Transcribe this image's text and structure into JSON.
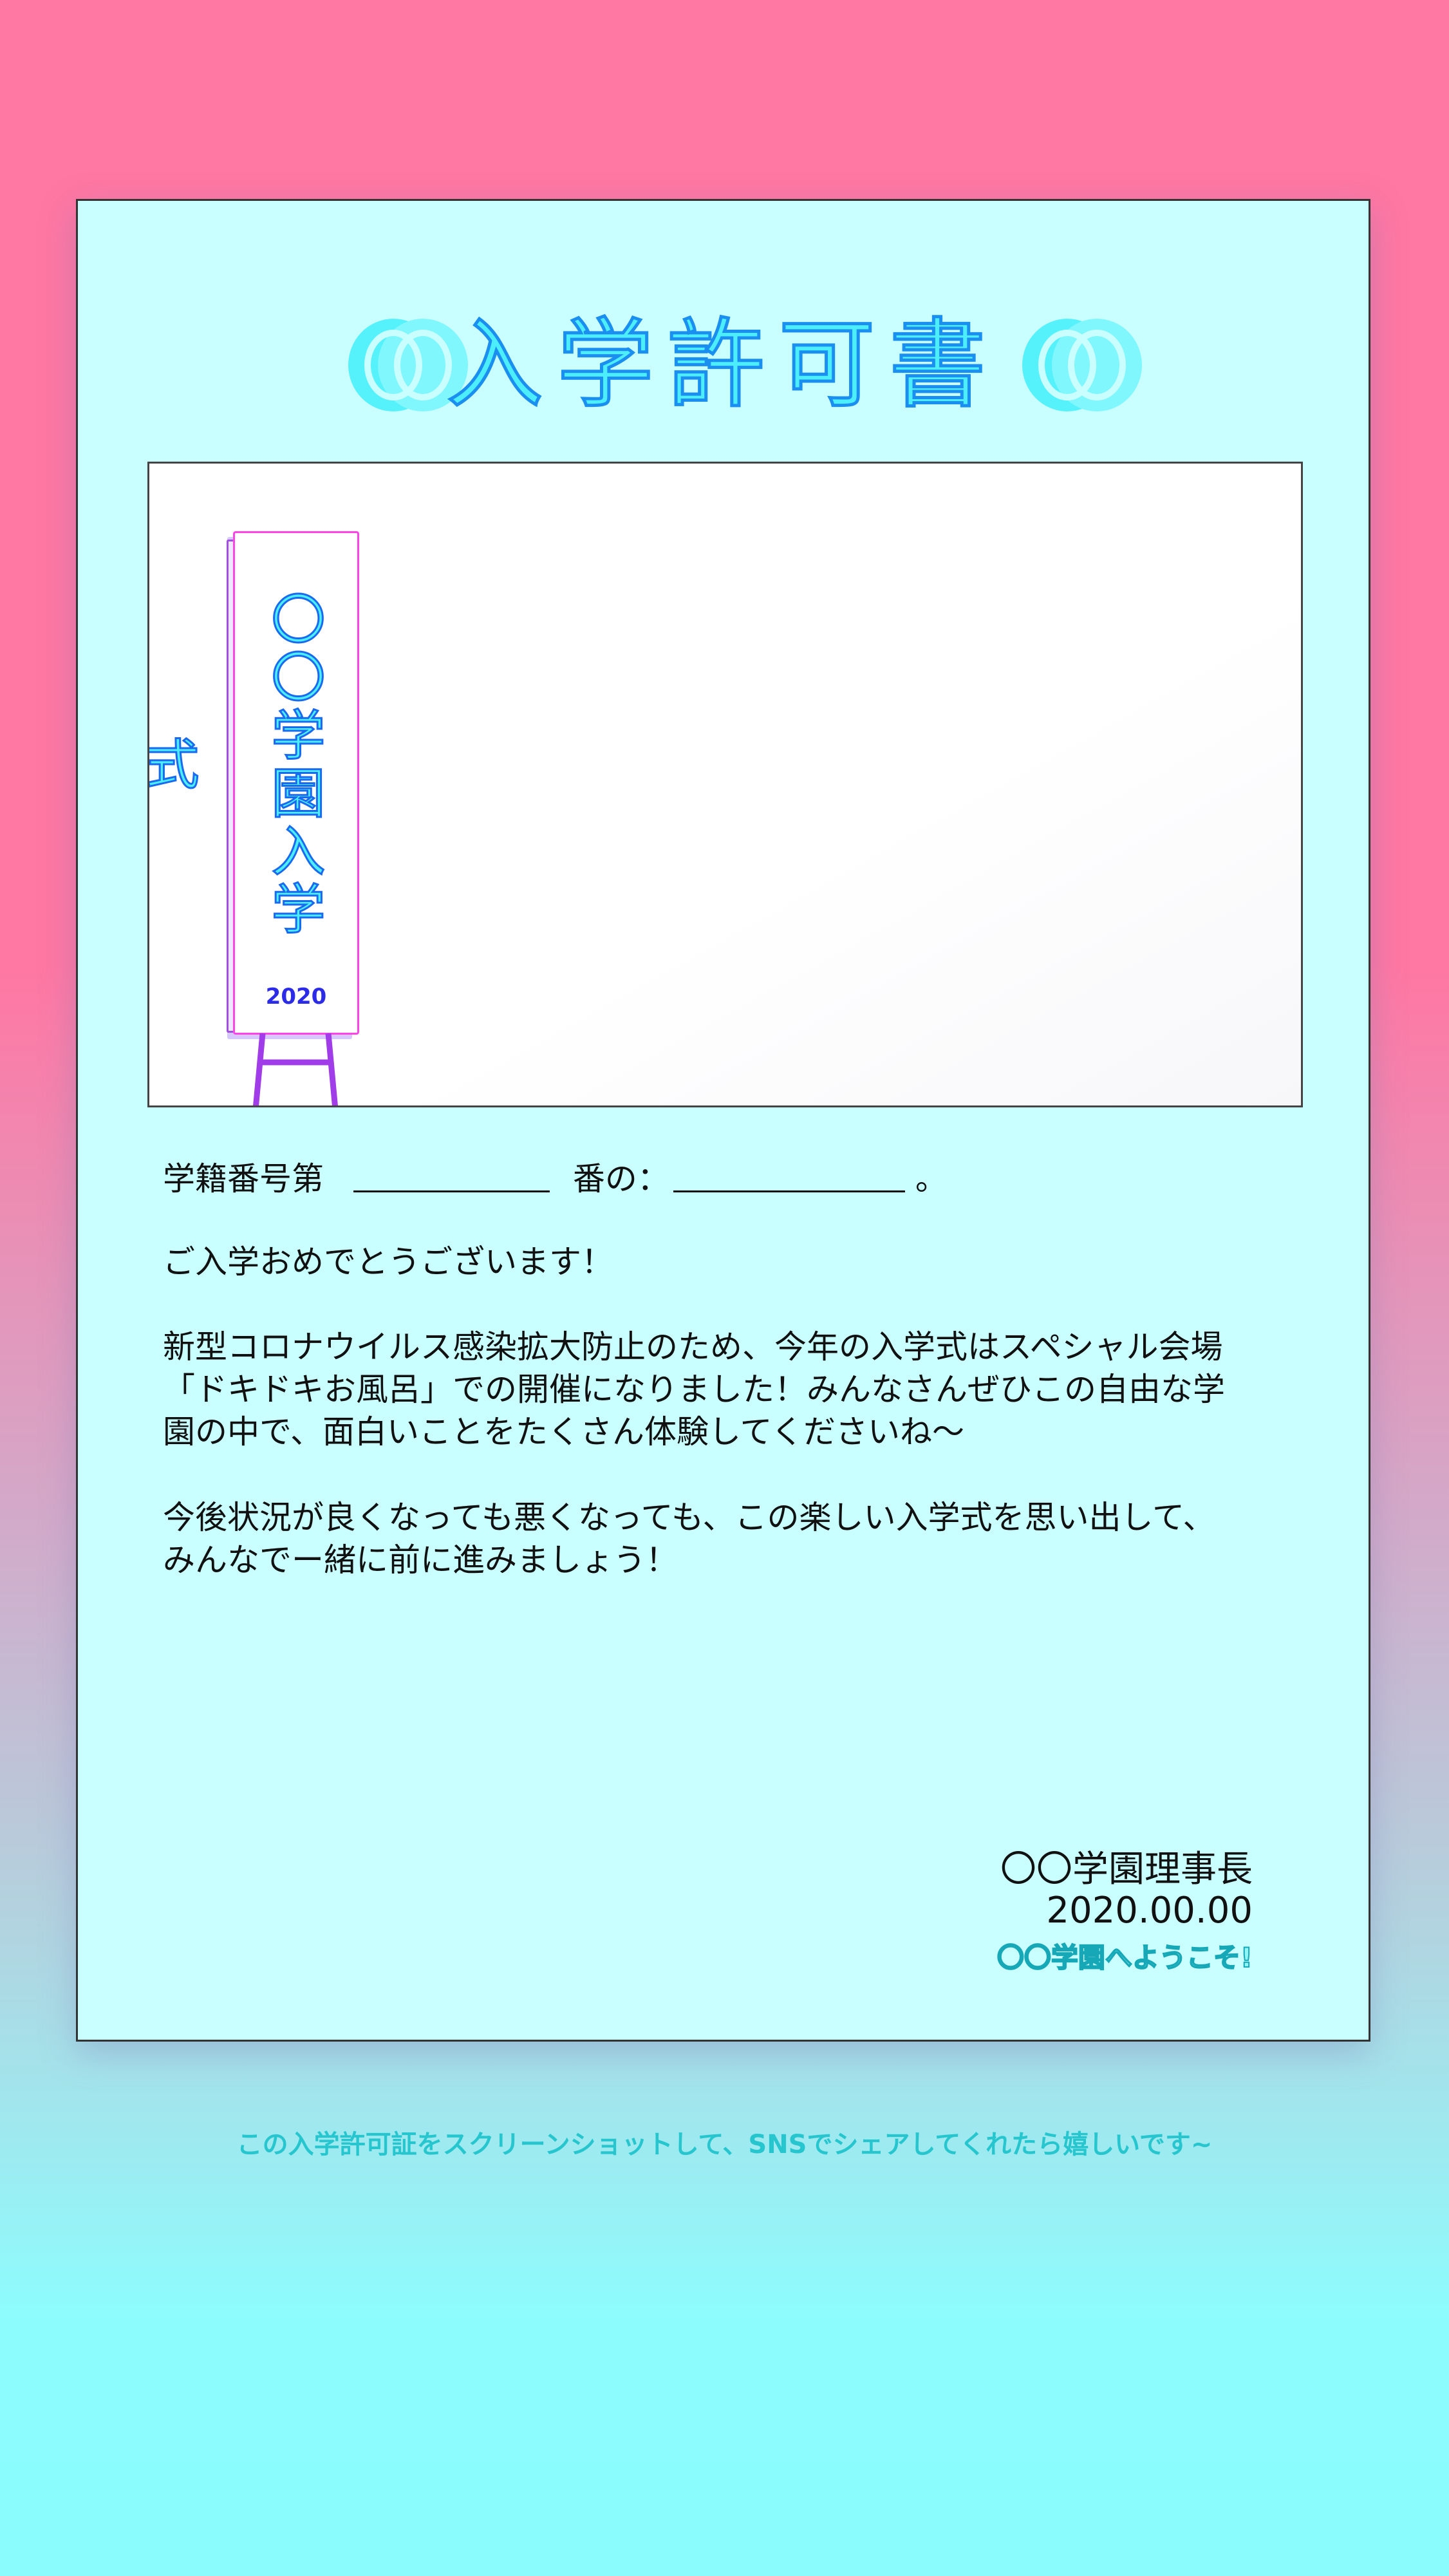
{
  "title": "入学許可書",
  "sign": {
    "text": "〇〇学園入学式",
    "year": "2020"
  },
  "form": {
    "prefix": "学籍番号第",
    "middle": "番の：",
    "suffix": "。"
  },
  "greeting": "ご入学おめでとうございます！",
  "paragraph1": "新型コロナウイルス感染拡大防止のため、今年の入学式はスペシャル会場\n「ドキドキお風呂」での開催になりました！みんなさんぜひこの自由な学\n園の中で、面白いことをたくさん体験してくださいね～",
  "paragraph2": "今後状況が良くなっても悪くなっても、この楽しい入学式を思い出して、\nみんなでー緒に前に進みましょう！",
  "signature": {
    "org": "〇〇学園理事長",
    "date": "2020.00.00",
    "welcome": "〇〇学園へようこそ!"
  },
  "footer_note": "この入学許可証をスクリーンショットして、SNSでシェアしてくれたら嬉しいです~",
  "colors": {
    "title_fill": "#4ceefb",
    "title_stroke": "#1a8ff0",
    "sign_border": "#ff44e7",
    "stand": "#a03ce8",
    "year": "#2c2ce8",
    "card": "#caffff",
    "footer": "#27c6cf"
  }
}
